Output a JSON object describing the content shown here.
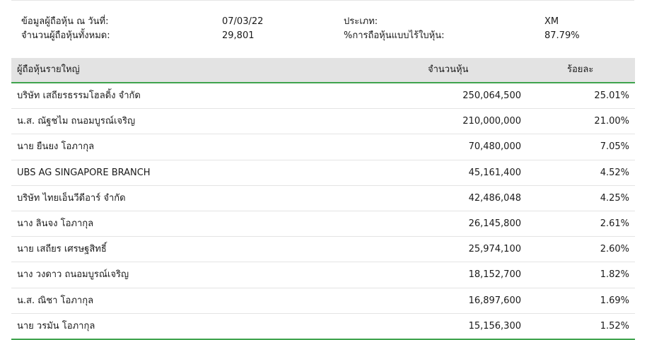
{
  "info": {
    "data_date_label": "ข้อมูลผู้ถือหุ้น ณ วันที่:",
    "data_date_value": "07/03/22",
    "type_label": "ประเภท:",
    "type_value": "XM",
    "total_holders_label": "จำนวนผู้ถือหุ้นทั้งหมด:",
    "total_holders_value": "29,801",
    "free_float_label": "%การถือหุ้นแบบไร้ใบหุ้น:",
    "free_float_value": "87.79%"
  },
  "table": {
    "headers": {
      "name": "ผู้ถือหุ้นรายใหญ่",
      "shares": "จำนวนหุ้น",
      "percent": "ร้อยละ"
    },
    "rows": [
      {
        "name": "บริษัท เสถียรธรรมโฮลดิ้ง จำกัด",
        "shares": "250,064,500",
        "percent": "25.01%"
      },
      {
        "name": "น.ส. ณัฐชไม ถนอมบูรณ์เจริญ",
        "shares": "210,000,000",
        "percent": "21.00%"
      },
      {
        "name": "นาย ยืนยง โอภากุล",
        "shares": "70,480,000",
        "percent": "7.05%"
      },
      {
        "name": "UBS AG SINGAPORE BRANCH",
        "shares": "45,161,400",
        "percent": "4.52%"
      },
      {
        "name": "บริษัท ไทยเอ็นวีดีอาร์ จำกัด",
        "shares": "42,486,048",
        "percent": "4.25%"
      },
      {
        "name": "นาง ลินจง โอภากุล",
        "shares": "26,145,800",
        "percent": "2.61%"
      },
      {
        "name": "นาย เสถียร เศรษฐสิทธิ์",
        "shares": "25,974,100",
        "percent": "2.60%"
      },
      {
        "name": "นาง วงดาว ถนอมบูรณ์เจริญ",
        "shares": "18,152,700",
        "percent": "1.82%"
      },
      {
        "name": "น.ส. ณิชา โอภากุล",
        "shares": "16,897,600",
        "percent": "1.69%"
      },
      {
        "name": "นาย วรมัน โอภากุล",
        "shares": "15,156,300",
        "percent": "1.52%"
      }
    ]
  },
  "colors": {
    "accent_green": "#3fa34d",
    "header_bg": "#e3e3e3"
  }
}
